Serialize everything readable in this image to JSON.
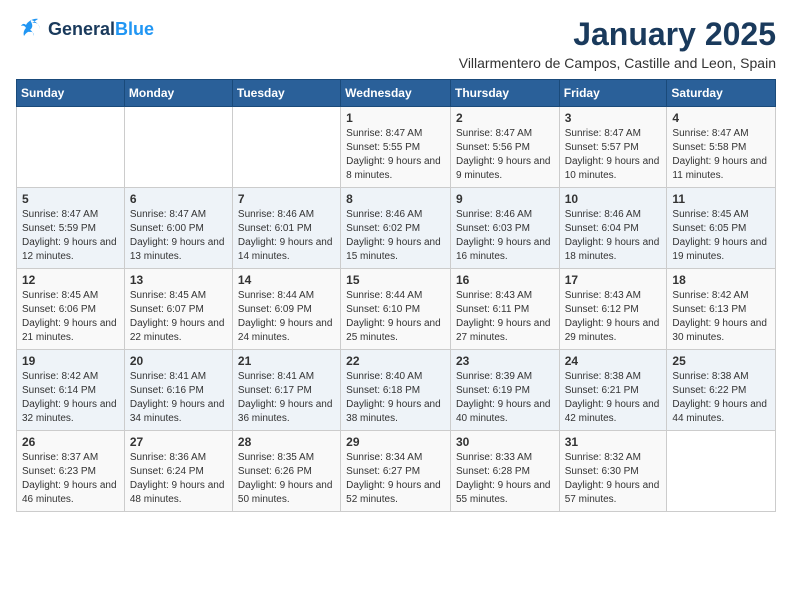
{
  "logo": {
    "line1": "General",
    "line2": "Blue"
  },
  "title": "January 2025",
  "subtitle": "Villarmentero de Campos, Castille and Leon, Spain",
  "days_of_week": [
    "Sunday",
    "Monday",
    "Tuesday",
    "Wednesday",
    "Thursday",
    "Friday",
    "Saturday"
  ],
  "weeks": [
    [
      {
        "day": "",
        "content": ""
      },
      {
        "day": "",
        "content": ""
      },
      {
        "day": "",
        "content": ""
      },
      {
        "day": "1",
        "content": "Sunrise: 8:47 AM\nSunset: 5:55 PM\nDaylight: 9 hours and 8 minutes."
      },
      {
        "day": "2",
        "content": "Sunrise: 8:47 AM\nSunset: 5:56 PM\nDaylight: 9 hours and 9 minutes."
      },
      {
        "day": "3",
        "content": "Sunrise: 8:47 AM\nSunset: 5:57 PM\nDaylight: 9 hours and 10 minutes."
      },
      {
        "day": "4",
        "content": "Sunrise: 8:47 AM\nSunset: 5:58 PM\nDaylight: 9 hours and 11 minutes."
      }
    ],
    [
      {
        "day": "5",
        "content": "Sunrise: 8:47 AM\nSunset: 5:59 PM\nDaylight: 9 hours and 12 minutes."
      },
      {
        "day": "6",
        "content": "Sunrise: 8:47 AM\nSunset: 6:00 PM\nDaylight: 9 hours and 13 minutes."
      },
      {
        "day": "7",
        "content": "Sunrise: 8:46 AM\nSunset: 6:01 PM\nDaylight: 9 hours and 14 minutes."
      },
      {
        "day": "8",
        "content": "Sunrise: 8:46 AM\nSunset: 6:02 PM\nDaylight: 9 hours and 15 minutes."
      },
      {
        "day": "9",
        "content": "Sunrise: 8:46 AM\nSunset: 6:03 PM\nDaylight: 9 hours and 16 minutes."
      },
      {
        "day": "10",
        "content": "Sunrise: 8:46 AM\nSunset: 6:04 PM\nDaylight: 9 hours and 18 minutes."
      },
      {
        "day": "11",
        "content": "Sunrise: 8:45 AM\nSunset: 6:05 PM\nDaylight: 9 hours and 19 minutes."
      }
    ],
    [
      {
        "day": "12",
        "content": "Sunrise: 8:45 AM\nSunset: 6:06 PM\nDaylight: 9 hours and 21 minutes."
      },
      {
        "day": "13",
        "content": "Sunrise: 8:45 AM\nSunset: 6:07 PM\nDaylight: 9 hours and 22 minutes."
      },
      {
        "day": "14",
        "content": "Sunrise: 8:44 AM\nSunset: 6:09 PM\nDaylight: 9 hours and 24 minutes."
      },
      {
        "day": "15",
        "content": "Sunrise: 8:44 AM\nSunset: 6:10 PM\nDaylight: 9 hours and 25 minutes."
      },
      {
        "day": "16",
        "content": "Sunrise: 8:43 AM\nSunset: 6:11 PM\nDaylight: 9 hours and 27 minutes."
      },
      {
        "day": "17",
        "content": "Sunrise: 8:43 AM\nSunset: 6:12 PM\nDaylight: 9 hours and 29 minutes."
      },
      {
        "day": "18",
        "content": "Sunrise: 8:42 AM\nSunset: 6:13 PM\nDaylight: 9 hours and 30 minutes."
      }
    ],
    [
      {
        "day": "19",
        "content": "Sunrise: 8:42 AM\nSunset: 6:14 PM\nDaylight: 9 hours and 32 minutes."
      },
      {
        "day": "20",
        "content": "Sunrise: 8:41 AM\nSunset: 6:16 PM\nDaylight: 9 hours and 34 minutes."
      },
      {
        "day": "21",
        "content": "Sunrise: 8:41 AM\nSunset: 6:17 PM\nDaylight: 9 hours and 36 minutes."
      },
      {
        "day": "22",
        "content": "Sunrise: 8:40 AM\nSunset: 6:18 PM\nDaylight: 9 hours and 38 minutes."
      },
      {
        "day": "23",
        "content": "Sunrise: 8:39 AM\nSunset: 6:19 PM\nDaylight: 9 hours and 40 minutes."
      },
      {
        "day": "24",
        "content": "Sunrise: 8:38 AM\nSunset: 6:21 PM\nDaylight: 9 hours and 42 minutes."
      },
      {
        "day": "25",
        "content": "Sunrise: 8:38 AM\nSunset: 6:22 PM\nDaylight: 9 hours and 44 minutes."
      }
    ],
    [
      {
        "day": "26",
        "content": "Sunrise: 8:37 AM\nSunset: 6:23 PM\nDaylight: 9 hours and 46 minutes."
      },
      {
        "day": "27",
        "content": "Sunrise: 8:36 AM\nSunset: 6:24 PM\nDaylight: 9 hours and 48 minutes."
      },
      {
        "day": "28",
        "content": "Sunrise: 8:35 AM\nSunset: 6:26 PM\nDaylight: 9 hours and 50 minutes."
      },
      {
        "day": "29",
        "content": "Sunrise: 8:34 AM\nSunset: 6:27 PM\nDaylight: 9 hours and 52 minutes."
      },
      {
        "day": "30",
        "content": "Sunrise: 8:33 AM\nSunset: 6:28 PM\nDaylight: 9 hours and 55 minutes."
      },
      {
        "day": "31",
        "content": "Sunrise: 8:32 AM\nSunset: 6:30 PM\nDaylight: 9 hours and 57 minutes."
      },
      {
        "day": "",
        "content": ""
      }
    ]
  ]
}
